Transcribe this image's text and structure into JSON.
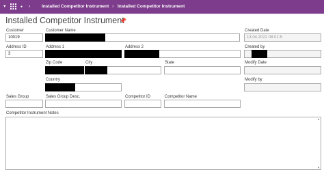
{
  "app": {
    "nav": {
      "back_icon": "caret-left-icon",
      "grid_icon": "app-grid-icon",
      "dot_icon": "dot-icon"
    },
    "breadcrumbs": [
      {
        "label": "Installed Competitor Instrument"
      },
      {
        "label": "Installed Competitor Instrument"
      }
    ]
  },
  "page": {
    "title": "Installed Competitor Instrument",
    "pin_icon": "pin-icon"
  },
  "form": {
    "customer": {
      "label": "Customer",
      "value": "10019"
    },
    "customer_name": {
      "label": "Customer Name",
      "value": ""
    },
    "created_date": {
      "label": "Created Date",
      "value": "13.04.2022 08:01:5"
    },
    "address_id": {
      "label": "Address ID",
      "value": "3"
    },
    "address1": {
      "label": "Address 1",
      "value": ""
    },
    "address2": {
      "label": "Address 2",
      "value": ""
    },
    "created_by": {
      "label": "Created by",
      "value": ""
    },
    "zip_code": {
      "label": "Zip Code",
      "value": ""
    },
    "city": {
      "label": "City",
      "value": ""
    },
    "state": {
      "label": "State",
      "value": ""
    },
    "modify_date": {
      "label": "Modify Date",
      "value": ""
    },
    "country": {
      "label": "Country",
      "value": ""
    },
    "modify_by": {
      "label": "Modify by",
      "value": ""
    },
    "sales_group": {
      "label": "Sales Group",
      "value": ""
    },
    "sales_group_desc": {
      "label": "Sales Group Desc.",
      "value": ""
    },
    "competitor_id": {
      "label": "Competitor ID",
      "value": ""
    },
    "competitor_name": {
      "label": "Competitor Name",
      "value": ""
    },
    "notes": {
      "label": "Competitor Instrument Notes",
      "value": ""
    }
  }
}
